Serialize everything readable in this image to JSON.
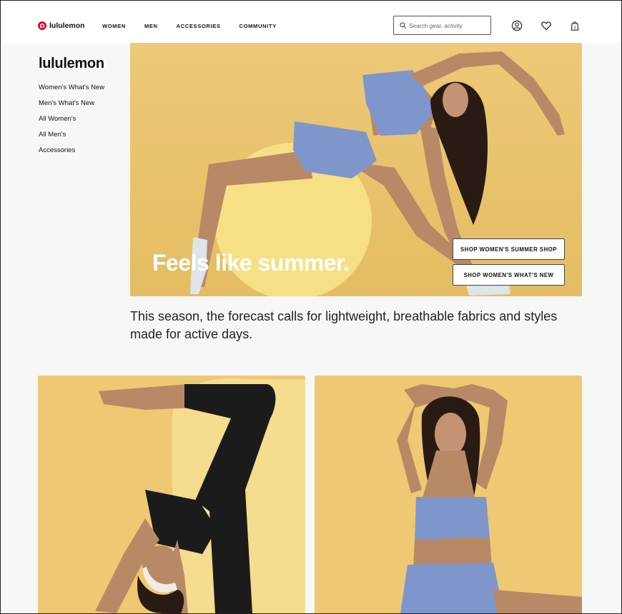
{
  "header": {
    "logo_text": "lululemon",
    "nav": [
      "WOMEN",
      "MEN",
      "ACCESSORIES",
      "COMMUNITY"
    ],
    "search_placeholder": "Search gear, activity",
    "icons": [
      "account-icon",
      "heart-icon",
      "bag-icon"
    ],
    "bag_count": "0"
  },
  "sidebar": {
    "brand": "lululemon",
    "items": [
      "Women's What's New",
      "Men's What's New",
      "All Women's",
      "All Men's",
      "Accessories"
    ]
  },
  "hero": {
    "headline": "Feels like summer.",
    "buttons": [
      "SHOP WOMEN'S SUMMER SHOP",
      "SHOP WOMEN'S WHAT'S NEW"
    ]
  },
  "intro_text": "This season, the forecast calls for lightweight, breathable fabrics and styles made for active days.",
  "colors": {
    "brand_red": "#c8102e",
    "hero_yellow": "#e9c46f",
    "sport_blue": "#7f96cc",
    "background": "#f7f7f7"
  }
}
